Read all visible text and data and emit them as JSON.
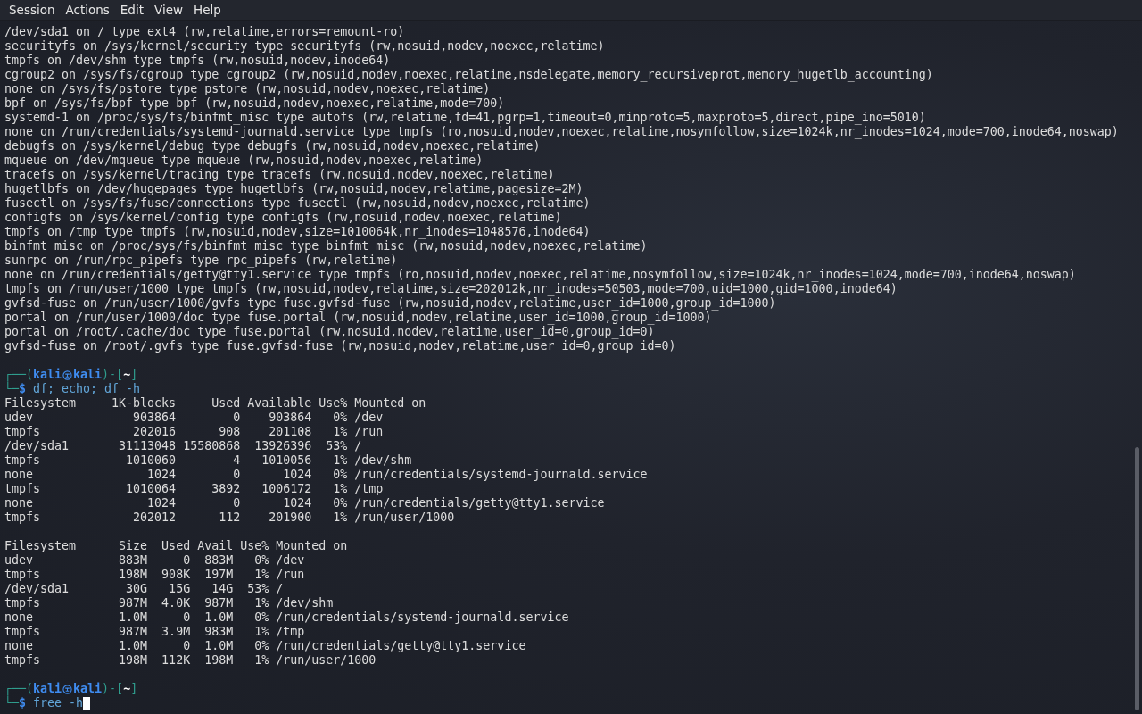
{
  "menu": [
    {
      "label": "Session"
    },
    {
      "label": "Actions"
    },
    {
      "label": "Edit"
    },
    {
      "label": "View"
    },
    {
      "label": "Help"
    }
  ],
  "lines": [
    {
      "kind": "output",
      "text": "/dev/sda1 on / type ext4 (rw,relatime,errors=remount-ro)"
    },
    {
      "kind": "output",
      "text": "securityfs on /sys/kernel/security type securityfs (rw,nosuid,nodev,noexec,relatime)"
    },
    {
      "kind": "output",
      "text": "tmpfs on /dev/shm type tmpfs (rw,nosuid,nodev,inode64)"
    },
    {
      "kind": "output",
      "text": "cgroup2 on /sys/fs/cgroup type cgroup2 (rw,nosuid,nodev,noexec,relatime,nsdelegate,memory_recursiveprot,memory_hugetlb_accounting)"
    },
    {
      "kind": "output",
      "text": "none on /sys/fs/pstore type pstore (rw,nosuid,nodev,noexec,relatime)"
    },
    {
      "kind": "output",
      "text": "bpf on /sys/fs/bpf type bpf (rw,nosuid,nodev,noexec,relatime,mode=700)"
    },
    {
      "kind": "output",
      "text": "systemd-1 on /proc/sys/fs/binfmt_misc type autofs (rw,relatime,fd=41,pgrp=1,timeout=0,minproto=5,maxproto=5,direct,pipe_ino=5010)"
    },
    {
      "kind": "output",
      "text": "none on /run/credentials/systemd-journald.service type tmpfs (ro,nosuid,nodev,noexec,relatime,nosymfollow,size=1024k,nr_inodes=1024,mode=700,inode64,noswap)"
    },
    {
      "kind": "output",
      "text": "debugfs on /sys/kernel/debug type debugfs (rw,nosuid,nodev,noexec,relatime)"
    },
    {
      "kind": "output",
      "text": "mqueue on /dev/mqueue type mqueue (rw,nosuid,nodev,noexec,relatime)"
    },
    {
      "kind": "output",
      "text": "tracefs on /sys/kernel/tracing type tracefs (rw,nosuid,nodev,noexec,relatime)"
    },
    {
      "kind": "output",
      "text": "hugetlbfs on /dev/hugepages type hugetlbfs (rw,nosuid,nodev,relatime,pagesize=2M)"
    },
    {
      "kind": "output",
      "text": "fusectl on /sys/fs/fuse/connections type fusectl (rw,nosuid,nodev,noexec,relatime)"
    },
    {
      "kind": "output",
      "text": "configfs on /sys/kernel/config type configfs (rw,nosuid,nodev,noexec,relatime)"
    },
    {
      "kind": "output",
      "text": "tmpfs on /tmp type tmpfs (rw,nosuid,nodev,size=1010064k,nr_inodes=1048576,inode64)"
    },
    {
      "kind": "output",
      "text": "binfmt_misc on /proc/sys/fs/binfmt_misc type binfmt_misc (rw,nosuid,nodev,noexec,relatime)"
    },
    {
      "kind": "output",
      "text": "sunrpc on /run/rpc_pipefs type rpc_pipefs (rw,relatime)"
    },
    {
      "kind": "output",
      "text": "none on /run/credentials/getty@tty1.service type tmpfs (ro,nosuid,nodev,noexec,relatime,nosymfollow,size=1024k,nr_inodes=1024,mode=700,inode64,noswap)"
    },
    {
      "kind": "output",
      "text": "tmpfs on /run/user/1000 type tmpfs (rw,nosuid,nodev,relatime,size=202012k,nr_inodes=50503,mode=700,uid=1000,gid=1000,inode64)"
    },
    {
      "kind": "output",
      "text": "gvfsd-fuse on /run/user/1000/gvfs type fuse.gvfsd-fuse (rw,nosuid,nodev,relatime,user_id=1000,group_id=1000)"
    },
    {
      "kind": "output",
      "text": "portal on /run/user/1000/doc type fuse.portal (rw,nosuid,nodev,relatime,user_id=1000,group_id=1000)"
    },
    {
      "kind": "output",
      "text": "portal on /root/.cache/doc type fuse.portal (rw,nosuid,nodev,relatime,user_id=0,group_id=0)"
    },
    {
      "kind": "output",
      "text": "gvfsd-fuse on /root/.gvfs type fuse.gvfsd-fuse (rw,nosuid,nodev,relatime,user_id=0,group_id=0)"
    },
    {
      "kind": "blank"
    },
    {
      "kind": "prompt",
      "frame_top": "┌──(",
      "user": "kali",
      "host": "kali",
      "path_open": ")-[",
      "dir": "~",
      "path_close": "]",
      "frame_bottom": "└─",
      "sign": "$",
      "command": "df; echo; df -h",
      "cursor": false
    },
    {
      "kind": "output",
      "text": "Filesystem     1K-blocks     Used Available Use% Mounted on"
    },
    {
      "kind": "output",
      "text": "udev              903864        0    903864   0% /dev"
    },
    {
      "kind": "output",
      "text": "tmpfs             202016      908    201108   1% /run"
    },
    {
      "kind": "output",
      "text": "/dev/sda1       31113048 15580868  13926396  53% /"
    },
    {
      "kind": "output",
      "text": "tmpfs            1010060        4   1010056   1% /dev/shm"
    },
    {
      "kind": "output",
      "text": "none                1024        0      1024   0% /run/credentials/systemd-journald.service"
    },
    {
      "kind": "output",
      "text": "tmpfs            1010064     3892   1006172   1% /tmp"
    },
    {
      "kind": "output",
      "text": "none                1024        0      1024   0% /run/credentials/getty@tty1.service"
    },
    {
      "kind": "output",
      "text": "tmpfs             202012      112    201900   1% /run/user/1000"
    },
    {
      "kind": "blank"
    },
    {
      "kind": "output",
      "text": "Filesystem      Size  Used Avail Use% Mounted on"
    },
    {
      "kind": "output",
      "text": "udev            883M     0  883M   0% /dev"
    },
    {
      "kind": "output",
      "text": "tmpfs           198M  908K  197M   1% /run"
    },
    {
      "kind": "output",
      "text": "/dev/sda1        30G   15G   14G  53% /"
    },
    {
      "kind": "output",
      "text": "tmpfs           987M  4.0K  987M   1% /dev/shm"
    },
    {
      "kind": "output",
      "text": "none            1.0M     0  1.0M   0% /run/credentials/systemd-journald.service"
    },
    {
      "kind": "output",
      "text": "tmpfs           987M  3.9M  983M   1% /tmp"
    },
    {
      "kind": "output",
      "text": "none            1.0M     0  1.0M   0% /run/credentials/getty@tty1.service"
    },
    {
      "kind": "output",
      "text": "tmpfs           198M  112K  198M   1% /run/user/1000"
    },
    {
      "kind": "blank"
    },
    {
      "kind": "prompt",
      "frame_top": "┌──(",
      "user": "kali",
      "host": "kali",
      "path_open": ")-[",
      "dir": "~",
      "path_close": "]",
      "frame_bottom": "└─",
      "sign": "$",
      "command": "free -h",
      "cursor": true
    }
  ]
}
